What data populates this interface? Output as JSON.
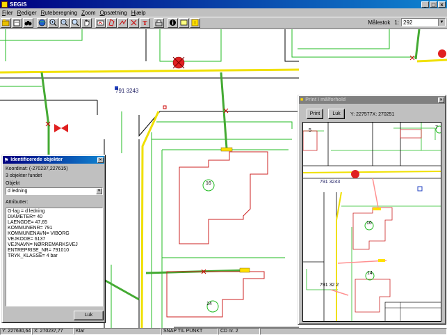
{
  "app": {
    "title": "SEGIS"
  },
  "window_buttons": [
    "_",
    "□",
    "×"
  ],
  "menu": [
    "Filer",
    "Rediger",
    "Ruteberegning",
    "Zoom",
    "Opsætning",
    "Hjælp"
  ],
  "toolbar_icons": [
    "open-icon",
    "print-setup-icon",
    "binoculars-icon",
    "globe-icon",
    "zoom-in-icon",
    "zoom-out-icon",
    "zoom-window-icon",
    "pan-hand-icon",
    "redraw-icon",
    "draw-polygon-icon",
    "draw-line-icon",
    "draw-cross-icon",
    "text-tool-icon",
    "print-icon",
    "info-icon",
    "rectangle-tool-icon",
    "layer-lamp-icon"
  ],
  "scale": {
    "label": "Målestok",
    "prefix": "1:",
    "value": "292"
  },
  "map": {
    "labels": {
      "main_id": "791 3243",
      "n16": "16",
      "n14": "14"
    },
    "colors": {
      "road": "#f0e000",
      "pipe": "#44aa33",
      "parcel": "#22bb22",
      "building": "#cc2222"
    }
  },
  "ident_panel": {
    "title": "Identificerede objekter",
    "coord_label": "Koordinat:",
    "coord_value": "(-270237,227615)",
    "found": "3 objekter fundet",
    "object_label": "Objekt",
    "object_value": "d ledning",
    "attr_label": "Attributter:",
    "attributes": [
      "G-lag = d ledning",
      "DIAMETER=  40",
      "LAENGDE=  47,65",
      "KOMMUNENR=  791",
      "KOMMUNENAVN=  VIBORG",
      "VEJKODE=  6137",
      "VEJNAVN=  NØRREMARKSVEJ",
      "ENTREPRISE_NR=  791010",
      "TRYK_KLASSE=  4 bar"
    ],
    "close_label": "Luk"
  },
  "print_panel": {
    "title": "Print i målforhold",
    "print_label": "Print",
    "close_label": "Luk",
    "coords": "Y: 227577X: 270251",
    "labels": {
      "n5": "5",
      "n7": "7",
      "main_id": "791 3243",
      "n16": "16",
      "n14": "14",
      "pipe_id": "791 32 2"
    }
  },
  "status": {
    "y": "Y: 227630,64",
    "x": "X: 270237,77",
    "state": "Klar",
    "snap": "SNAP TIL PUNKT",
    "cd": "CD nr. 2"
  }
}
